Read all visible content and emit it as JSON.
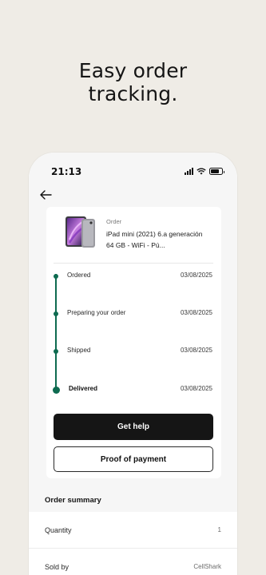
{
  "headline": {
    "line1": "Easy order",
    "line2": "tracking."
  },
  "status_bar": {
    "time": "21:13"
  },
  "icons": {
    "back": "arrow-left-icon",
    "signal": "cellular-signal-icon",
    "wifi": "wifi-icon",
    "battery": "battery-icon"
  },
  "order": {
    "label": "Order",
    "product_name": "iPad mini (2021) 6.a generación 64 GB - WiFi - Pú..."
  },
  "timeline": [
    {
      "label": "Ordered",
      "date": "03/08/2025"
    },
    {
      "label": "Preparing your order",
      "date": "03/08/2025"
    },
    {
      "label": "Shipped",
      "date": "03/08/2025"
    },
    {
      "label": "Delivered",
      "date": "03/08/2025"
    }
  ],
  "actions": {
    "get_help": "Get help",
    "proof_of_payment": "Proof of payment"
  },
  "summary": {
    "title": "Order summary",
    "rows": [
      {
        "key": "Quantity",
        "value": "1"
      },
      {
        "key": "Sold by",
        "value": "CellShark"
      }
    ]
  },
  "colors": {
    "accent": "#0e6b50",
    "background": "#efece6",
    "primary_button": "#151515"
  }
}
